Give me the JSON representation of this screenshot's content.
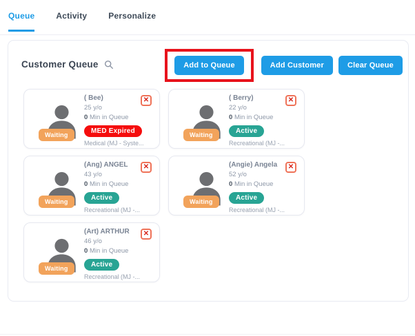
{
  "tabs": [
    {
      "label": "Queue",
      "active": true
    },
    {
      "label": "Activity",
      "active": false
    },
    {
      "label": "Personalize",
      "active": false
    }
  ],
  "panel": {
    "title": "Customer Queue",
    "buttons": {
      "add_to_queue": "Add to Queue",
      "add_customer": "Add Customer",
      "clear_queue": "Clear Queue"
    }
  },
  "icons": {
    "search": "magnifying-glass",
    "close": "x-in-square",
    "avatar": "person-silhouette"
  },
  "colors": {
    "accent_blue": "#1e9ce6",
    "annotation_red": "#e8131c",
    "badge_red": "#f50d0d",
    "badge_teal": "#28a494",
    "badge_orange": "#f2a35b"
  },
  "close_glyph": "✕",
  "cards": [
    {
      "name": "( Bee)",
      "age": "25 y/o",
      "queue_min": "0",
      "queue_label": "Min in Queue",
      "status": "MED Expired",
      "status_color": "#f50d0d",
      "type": "Medical (MJ - Syste...",
      "queue_state": "Waiting"
    },
    {
      "name": "( Berry)",
      "age": "22 y/o",
      "queue_min": "0",
      "queue_label": "Min in Queue",
      "status": "Active",
      "status_color": "#28a494",
      "type": "Recreational (MJ -...",
      "queue_state": "Waiting"
    },
    {
      "name": "(Ang) ANGEL",
      "age": "43 y/o",
      "queue_min": "0",
      "queue_label": "Min in Queue",
      "status": "Active",
      "status_color": "#28a494",
      "type": "Recreational (MJ -...",
      "queue_state": "Waiting"
    },
    {
      "name": "(Angie) Angela",
      "age": "52 y/o",
      "queue_min": "0",
      "queue_label": "Min in Queue",
      "status": "Active",
      "status_color": "#28a494",
      "type": "Recreational (MJ -...",
      "queue_state": "Waiting"
    },
    {
      "name": "(Art) ARTHUR",
      "age": "46 y/o",
      "queue_min": "0",
      "queue_label": "Min in Queue",
      "status": "Active",
      "status_color": "#28a494",
      "type": "Recreational (MJ -...",
      "queue_state": "Waiting"
    }
  ]
}
